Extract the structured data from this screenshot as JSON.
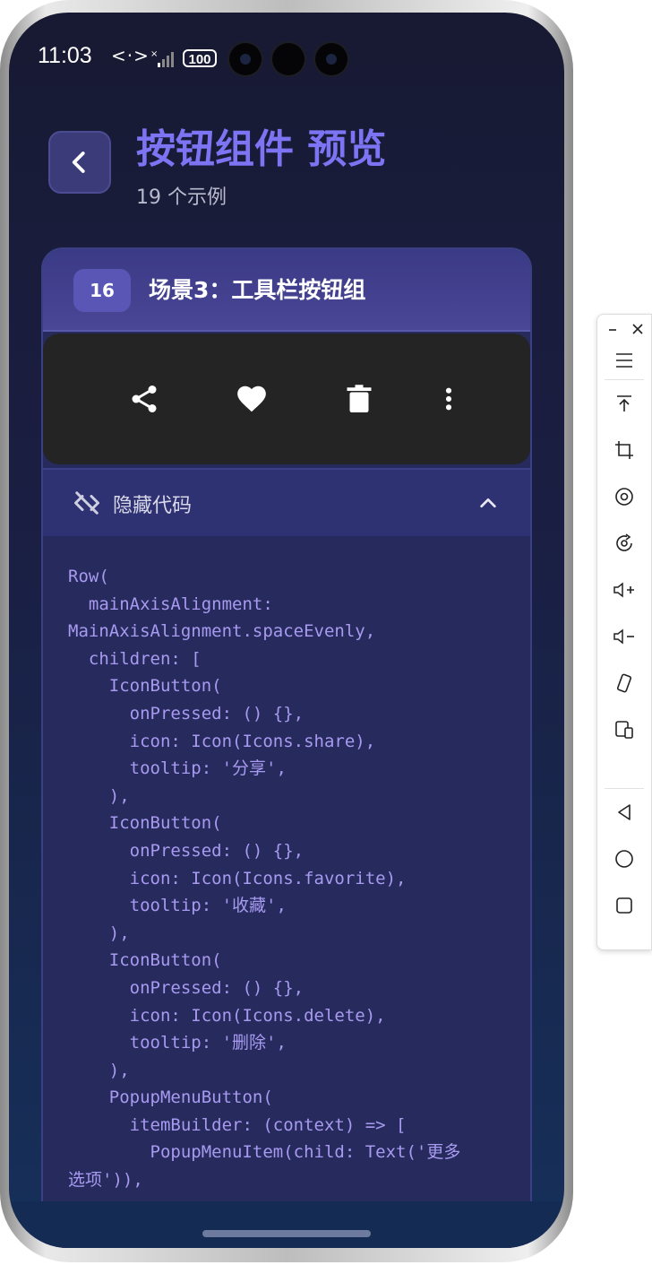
{
  "status_bar": {
    "time": "11:03",
    "network": "<·>",
    "battery": "100"
  },
  "header": {
    "title": "按钮组件 预览",
    "subtitle": "19 个示例"
  },
  "card": {
    "index": "16",
    "title": "场景3：工具栏按钮组",
    "toolbar_icons": [
      "share-icon",
      "favorite-icon",
      "delete-icon",
      "more-vert-icon"
    ],
    "toggle_label": "隐藏代码",
    "code_lines": [
      "Row(",
      "  mainAxisAlignment:",
      "MainAxisAlignment.spaceEvenly,",
      "  children: [",
      "    IconButton(",
      "      onPressed: () {},",
      "      icon: Icon(Icons.share),",
      "      tooltip: '分享',",
      "    ),",
      "    IconButton(",
      "      onPressed: () {},",
      "      icon: Icon(Icons.favorite),",
      "      tooltip: '收藏',",
      "    ),",
      "    IconButton(",
      "      onPressed: () {},",
      "      icon: Icon(Icons.delete),",
      "      tooltip: '删除',",
      "    ),",
      "    PopupMenuButton(",
      "      itemBuilder: (context) => [",
      "        PopupMenuItem(child: Text('更多",
      "选项')),"
    ]
  },
  "colors": {
    "accent": "#7c74f2",
    "code_text": "#a89af0",
    "card_header": "#4a4796"
  },
  "side_panel_icons": [
    "minimize-icon",
    "close-icon",
    "menu-icon",
    "pin-top-icon",
    "crop-icon",
    "record-icon",
    "rotate-screen-icon",
    "volume-up-icon",
    "volume-down-icon",
    "shake-icon",
    "multi-device-icon",
    "back-nav-icon",
    "home-nav-icon",
    "recents-nav-icon"
  ]
}
